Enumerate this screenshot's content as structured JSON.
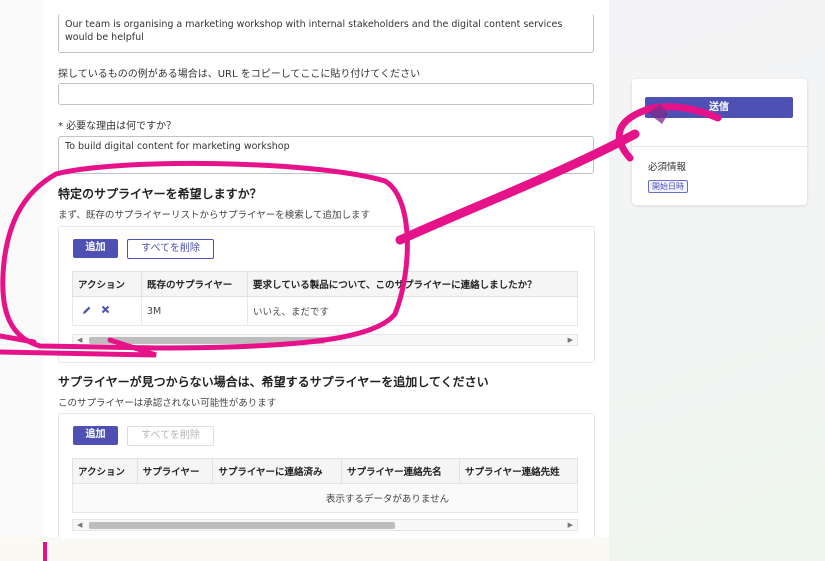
{
  "colors": {
    "accent": "#4e51b3",
    "annotation": "#e5128a"
  },
  "form": {
    "prev_text": "Our team is organising a marketing workshop with internal stakeholders and the digital content services would be helpful",
    "url_label": "探しているものの例がある場合は、URL をコピーしてここに貼り付けてください",
    "url_value": "",
    "reason_label": "* 必要な理由は何ですか？",
    "reason_value": "To build digital content for marketing workshop"
  },
  "preferred_suppliers": {
    "title": "特定のサプライヤーを希望しますか？",
    "desc": "まず、既存のサプライヤーリストからサプライヤーを検索して追加します",
    "add_label": "追加",
    "delete_all_label": "すべてを削除",
    "columns": [
      "アクション",
      "既存のサプライヤー",
      "要求している製品について、このサプライヤーに連絡しましたか？"
    ],
    "rows": [
      {
        "supplier": "3M",
        "contacted": "いいえ、まだです"
      }
    ],
    "row_icons": [
      "edit-pencil-icon",
      "delete-x-icon"
    ]
  },
  "new_suppliers": {
    "title": "サプライヤーが見つからない場合は、希望するサプライヤーを追加してください",
    "desc": "このサプライヤーは承認されない可能性があります",
    "add_label": "追加",
    "delete_all_label": "すべてを削除",
    "columns": [
      "アクション",
      "サプライヤー",
      "サプライヤーに連絡済み",
      "サプライヤー連絡先名",
      "サプライヤー連絡先姓"
    ],
    "empty_text": "表示するデータがありません"
  },
  "sidebar": {
    "submit_label": "送信",
    "required_label": "必須情報",
    "required_badge": "開始日時"
  }
}
